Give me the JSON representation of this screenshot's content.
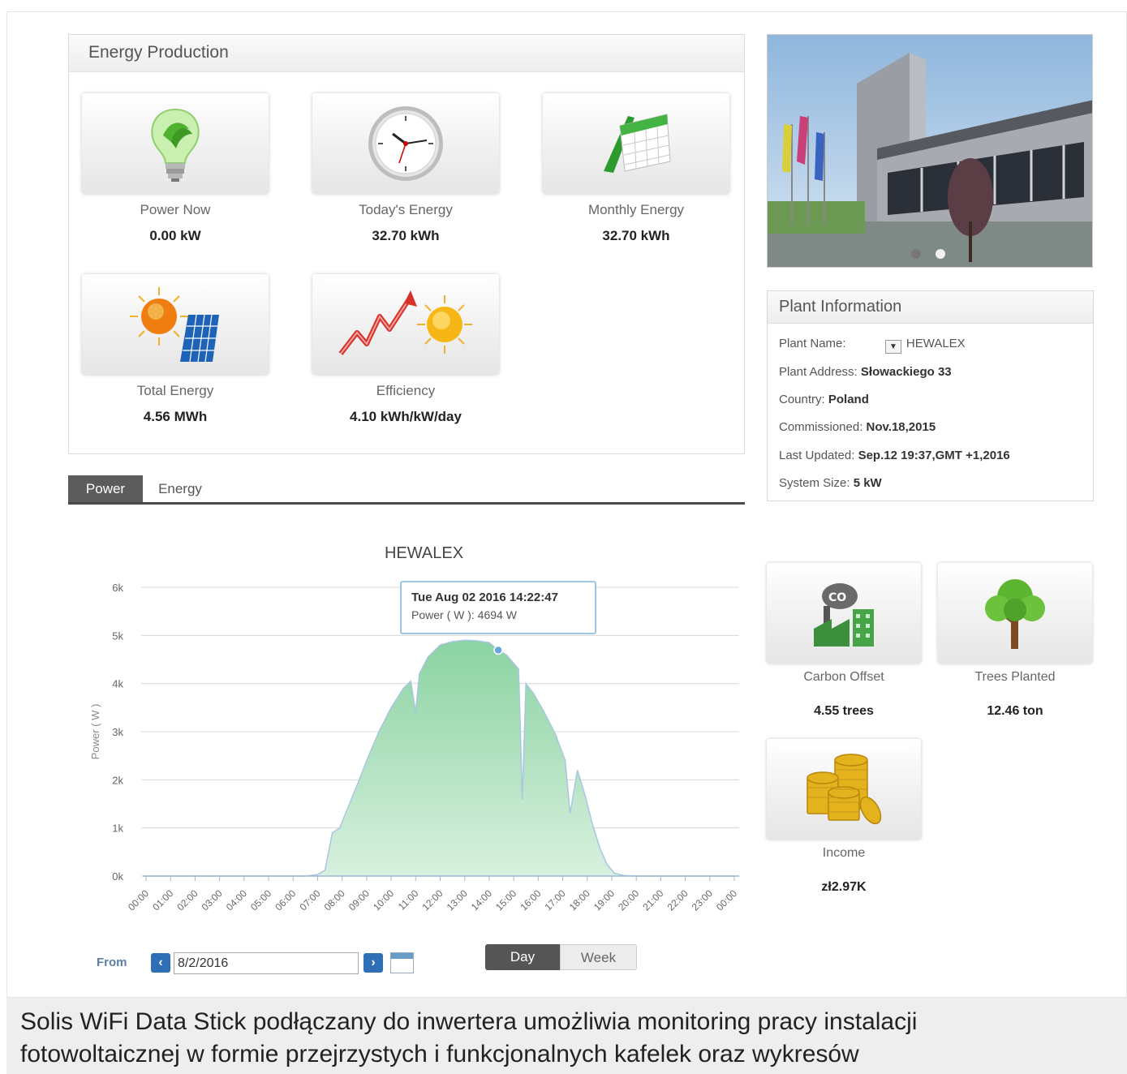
{
  "energy_production": {
    "title": "Energy Production",
    "tiles": [
      {
        "label": "Power Now",
        "value": "0.00 kW",
        "icon": "lightbulb-icon"
      },
      {
        "label": "Today's Energy",
        "value": "32.70 kWh",
        "icon": "clock-icon"
      },
      {
        "label": "Monthly Energy",
        "value": "32.70 kWh",
        "icon": "calendar-icon"
      },
      {
        "label": "Total Energy",
        "value": "4.56 MWh",
        "icon": "sun-solar-panel-icon"
      },
      {
        "label": "Efficiency",
        "value": "4.10 kWh/kW/day",
        "icon": "growth-arrow-sun-icon"
      }
    ]
  },
  "tabs": [
    {
      "label": "Power",
      "active": true
    },
    {
      "label": "Energy",
      "active": false
    }
  ],
  "chart_data": {
    "type": "area",
    "title": "HEWALEX",
    "ylabel": "Power ( W )",
    "xlabel": "",
    "ylim": [
      0,
      6000
    ],
    "yticks": [
      "0k",
      "1k",
      "2k",
      "3k",
      "4k",
      "5k",
      "6k"
    ],
    "x_tick_labels": [
      "00:00",
      "01:00",
      "02:00",
      "03:00",
      "04:00",
      "05:00",
      "06:00",
      "07:00",
      "08:00",
      "09:00",
      "10:00",
      "11:00",
      "12:00",
      "13:00",
      "14:00",
      "15:00",
      "16:00",
      "17:00",
      "18:00",
      "19:00",
      "20:00",
      "21:00",
      "22:00",
      "23:00",
      "00:00"
    ],
    "series": [
      {
        "color": "#7fcf9a",
        "points": [
          [
            0,
            0
          ],
          [
            6.5,
            0
          ],
          [
            7,
            30
          ],
          [
            7.3,
            120
          ],
          [
            7.6,
            900
          ],
          [
            7.9,
            1000
          ],
          [
            8.3,
            1500
          ],
          [
            8.7,
            2000
          ],
          [
            9,
            2400
          ],
          [
            9.5,
            3000
          ],
          [
            10,
            3500
          ],
          [
            10.5,
            3900
          ],
          [
            10.8,
            4050
          ],
          [
            11.0,
            3400
          ],
          [
            11.15,
            4200
          ],
          [
            11.5,
            4550
          ],
          [
            12,
            4800
          ],
          [
            12.5,
            4870
          ],
          [
            13,
            4900
          ],
          [
            13.5,
            4890
          ],
          [
            14,
            4850
          ],
          [
            14.37,
            4694
          ],
          [
            14.7,
            4600
          ],
          [
            15.2,
            4300
          ],
          [
            15.35,
            1600
          ],
          [
            15.5,
            4000
          ],
          [
            15.8,
            3800
          ],
          [
            16.2,
            3450
          ],
          [
            16.7,
            2950
          ],
          [
            17.1,
            2400
          ],
          [
            17.3,
            1300
          ],
          [
            17.6,
            2200
          ],
          [
            17.9,
            1700
          ],
          [
            18.2,
            1100
          ],
          [
            18.5,
            600
          ],
          [
            18.8,
            250
          ],
          [
            19.1,
            60
          ],
          [
            19.5,
            10
          ],
          [
            20,
            0
          ],
          [
            24,
            0
          ]
        ]
      }
    ],
    "tooltip": {
      "time": "Tue Aug 02 2016 14:22:47",
      "text": "Power ( W ): 4694 W",
      "x": 14.37,
      "y": 4694
    },
    "grid": true
  },
  "controls": {
    "from_label": "From",
    "date_value": "8/2/2016",
    "range_day": "Day",
    "range_week": "Week"
  },
  "plant_info": {
    "title": "Plant Information",
    "name_label": "Plant Name:",
    "name_value": "HEWALEX",
    "address_label": "Plant Address:",
    "address_value": "Słowackiego 33",
    "country_label": "Country:",
    "country_value": "Poland",
    "commissioned_label": "Commissioned:",
    "commissioned_value": "Nov.18,2015",
    "updated_label": "Last Updated:",
    "updated_value": "Sep.12 19:37,GMT +1,2016",
    "size_label": "System Size:",
    "size_value": "5 kW"
  },
  "stats": [
    {
      "label": "Carbon Offset",
      "value": "4.55 trees",
      "icon": "co2-factory-icon"
    },
    {
      "label": "Trees Planted",
      "value": "12.46 ton",
      "icon": "tree-icon"
    },
    {
      "label": "Income",
      "value": "zł2.97K",
      "icon": "coins-icon"
    }
  ],
  "caption": {
    "line1": "Solis WiFi Data Stick podłączany do inwertera umożliwia monitoring pracy instalacji",
    "line2": "fotowoltaicznej w formie przejrzystych i funkcjonalnych kafelek oraz wykresów"
  }
}
